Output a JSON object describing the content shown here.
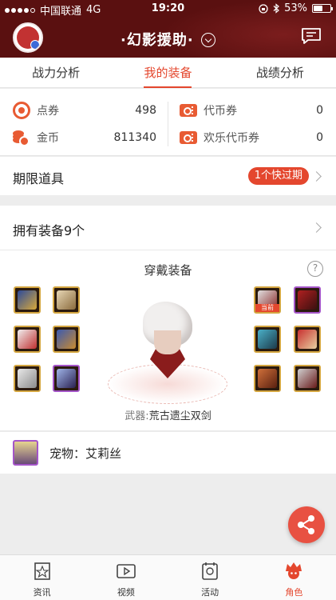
{
  "status_bar": {
    "carrier": "中国联通",
    "network": "4G",
    "time": "19:20",
    "battery": "53%",
    "battery_level": 0.53
  },
  "header": {
    "server_name": "·幻影援助·"
  },
  "tabs": [
    {
      "label": "战力分析",
      "active": false
    },
    {
      "label": "我的装备",
      "active": true
    },
    {
      "label": "战绩分析",
      "active": false
    }
  ],
  "currency": {
    "coupon_label": "点券",
    "coupon_value": "498",
    "gold_label": "金币",
    "gold_value": "811340",
    "token_label": "代币券",
    "token_value": "0",
    "happy_token_label": "欢乐代币券",
    "happy_token_value": "0"
  },
  "limited": {
    "title": "期限道具",
    "badge": "1个快过期"
  },
  "equipment": {
    "owned_title": "拥有装备9个",
    "heading": "穿戴装备",
    "help": "?",
    "current_badge": "当前",
    "weapon_label": "武器:",
    "weapon_name": "荒古遗尘双剑"
  },
  "pet": {
    "text": "宠物：艾莉丝"
  },
  "bottom_nav": [
    {
      "label": "资讯",
      "icon": "news-book-icon",
      "active": false
    },
    {
      "label": "视频",
      "icon": "video-play-icon",
      "active": false
    },
    {
      "label": "活动",
      "icon": "activity-gift-icon",
      "active": false
    },
    {
      "label": "角色",
      "icon": "character-avatar-icon",
      "active": true
    }
  ],
  "colors": {
    "accent": "#e4472e",
    "header_bg": "#5a1010"
  }
}
